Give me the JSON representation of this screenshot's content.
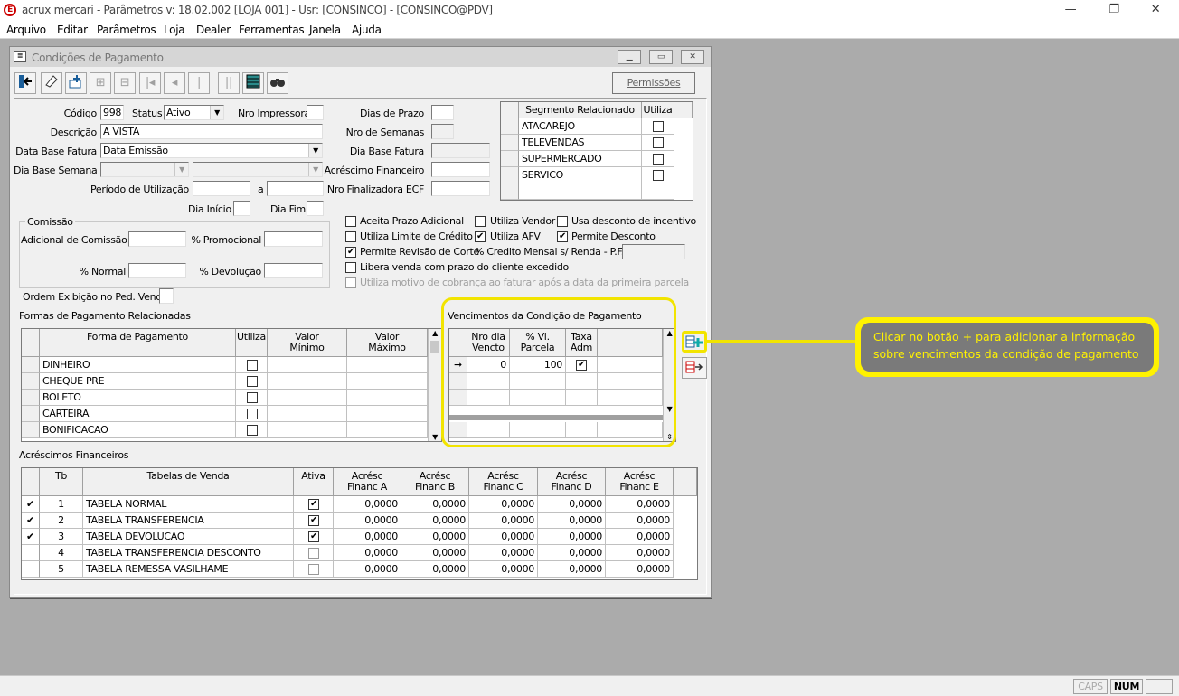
{
  "window": {
    "title": "acrux mercari - Parâmetros  v: 18.02.002  [LOJA 001] - Usr: [CONSINCO] - [CONSINCO@PDV]",
    "minimize": "—",
    "restore": "❐",
    "close": "✕"
  },
  "menu": [
    "Arquivo",
    "Editar",
    "Parâmetros",
    "Loja",
    "Dealer",
    "Ferramentas",
    "Janela",
    "Ajuda"
  ],
  "child": {
    "title": "Condições de Pagamento",
    "permissions_button": "Permissões"
  },
  "form": {
    "codigo_label": "Código",
    "codigo": "998",
    "status_label": "Status",
    "status": "Ativo",
    "nro_impressora_label": "Nro Impressora",
    "descricao_label": "Descrição",
    "descricao": "A VISTA",
    "data_base_fatura_label": "Data Base Fatura",
    "data_base_fatura": "Data Emissão",
    "dia_base_semana_label": "Dia Base Semana",
    "periodo_label": "Período de Utilização",
    "periodo_a": "a",
    "dia_inicio_label": "Dia Início",
    "dia_fim_label": "Dia Fim",
    "dias_prazo_label": "Dias de Prazo",
    "nro_semanas_label": "Nro de Semanas",
    "dia_base_fatura_label": "Dia Base Fatura",
    "acrescimo_financeiro_label": "Acréscimo Financeiro",
    "nro_finalizadora_label": "Nro Finalizadora ECF",
    "ordem_exibicao_label": "Ordem Exibição no Ped. Venda"
  },
  "comissao": {
    "title": "Comissão",
    "adicional_label": "Adicional de Comissão",
    "promocional_label": "% Promocional",
    "normal_label": "% Normal",
    "devolucao_label": "% Devolução"
  },
  "segmento": {
    "headers": [
      "Segmento Relacionado",
      "Utiliza"
    ],
    "rows": [
      "ATACAREJO",
      "TELEVENDAS",
      "SUPERMERCADO",
      "SERVICO"
    ]
  },
  "options": {
    "aceita_prazo": "Aceita Prazo Adicional",
    "utiliza_vendor": "Utiliza Vendor",
    "usa_desconto": "Usa desconto de incentivo",
    "utiliza_limite": "Utiliza Limite de Crédito",
    "utiliza_afv": "Utiliza AFV",
    "permite_desconto": "Permite Desconto",
    "permite_revisao": "Permite Revisão de Corte",
    "credito_mensal": "% Credito Mensal s/ Renda - P.F.",
    "libera_venda": "Libera venda com prazo do cliente excedido",
    "utiliza_motivo": "Utiliza motivo de cobrança ao faturar após a data da primeira parcela"
  },
  "formas": {
    "title": "Formas de Pagamento Relacionadas",
    "headers": [
      "Forma de Pagamento",
      "Utiliza",
      "Valor\nMínimo",
      "Valor\nMáximo"
    ],
    "rows": [
      "DINHEIRO",
      "CHEQUE PRE",
      "BOLETO",
      "CARTEIRA",
      "BONIFICACAO"
    ]
  },
  "vencimentos": {
    "title": "Vencimentos da Condição de Pagamento",
    "headers": [
      "Nro dia\nVencto",
      "% Vl.\nParcela",
      "Taxa\nAdm"
    ],
    "row": {
      "dia": "0",
      "parcela": "100"
    }
  },
  "acrescimos": {
    "title": "Acréscimos Financeiros",
    "headers": [
      "Tb",
      "Tabelas de Venda",
      "Ativa",
      "Acrésc\nFinanc A",
      "Acrésc\nFinanc B",
      "Acrésc\nFinanc C",
      "Acrésc\nFinanc D",
      "Acrésc\nFinanc E"
    ],
    "rows": [
      {
        "tb": "1",
        "nome": "TABELA NORMAL",
        "a": "0,0000",
        "b": "0,0000",
        "c": "0,0000",
        "d": "0,0000",
        "e": "0,0000"
      },
      {
        "tb": "2",
        "nome": "TABELA TRANSFERENCIA",
        "a": "0,0000",
        "b": "0,0000",
        "c": "0,0000",
        "d": "0,0000",
        "e": "0,0000"
      },
      {
        "tb": "3",
        "nome": "TABELA DEVOLUCAO",
        "a": "0,0000",
        "b": "0,0000",
        "c": "0,0000",
        "d": "0,0000",
        "e": "0,0000"
      },
      {
        "tb": "4",
        "nome": "TABELA TRANSFERENCIA DESCONTO",
        "a": "0,0000",
        "b": "0,0000",
        "c": "0,0000",
        "d": "0,0000",
        "e": "0,0000"
      },
      {
        "tb": "5",
        "nome": "TABELA REMESSA VASILHAME",
        "a": "0,0000",
        "b": "0,0000",
        "c": "0,0000",
        "d": "0,0000",
        "e": "0,0000"
      }
    ]
  },
  "callout": "Clicar no botão + para adicionar a informação\nsobre vencimentos da condição de pagamento",
  "status": {
    "caps": "CAPS",
    "num": "NUM"
  },
  "colors": {
    "highlight": "#f2e400",
    "callout_bg": "#7a7a7a",
    "workspace": "#ababab"
  }
}
